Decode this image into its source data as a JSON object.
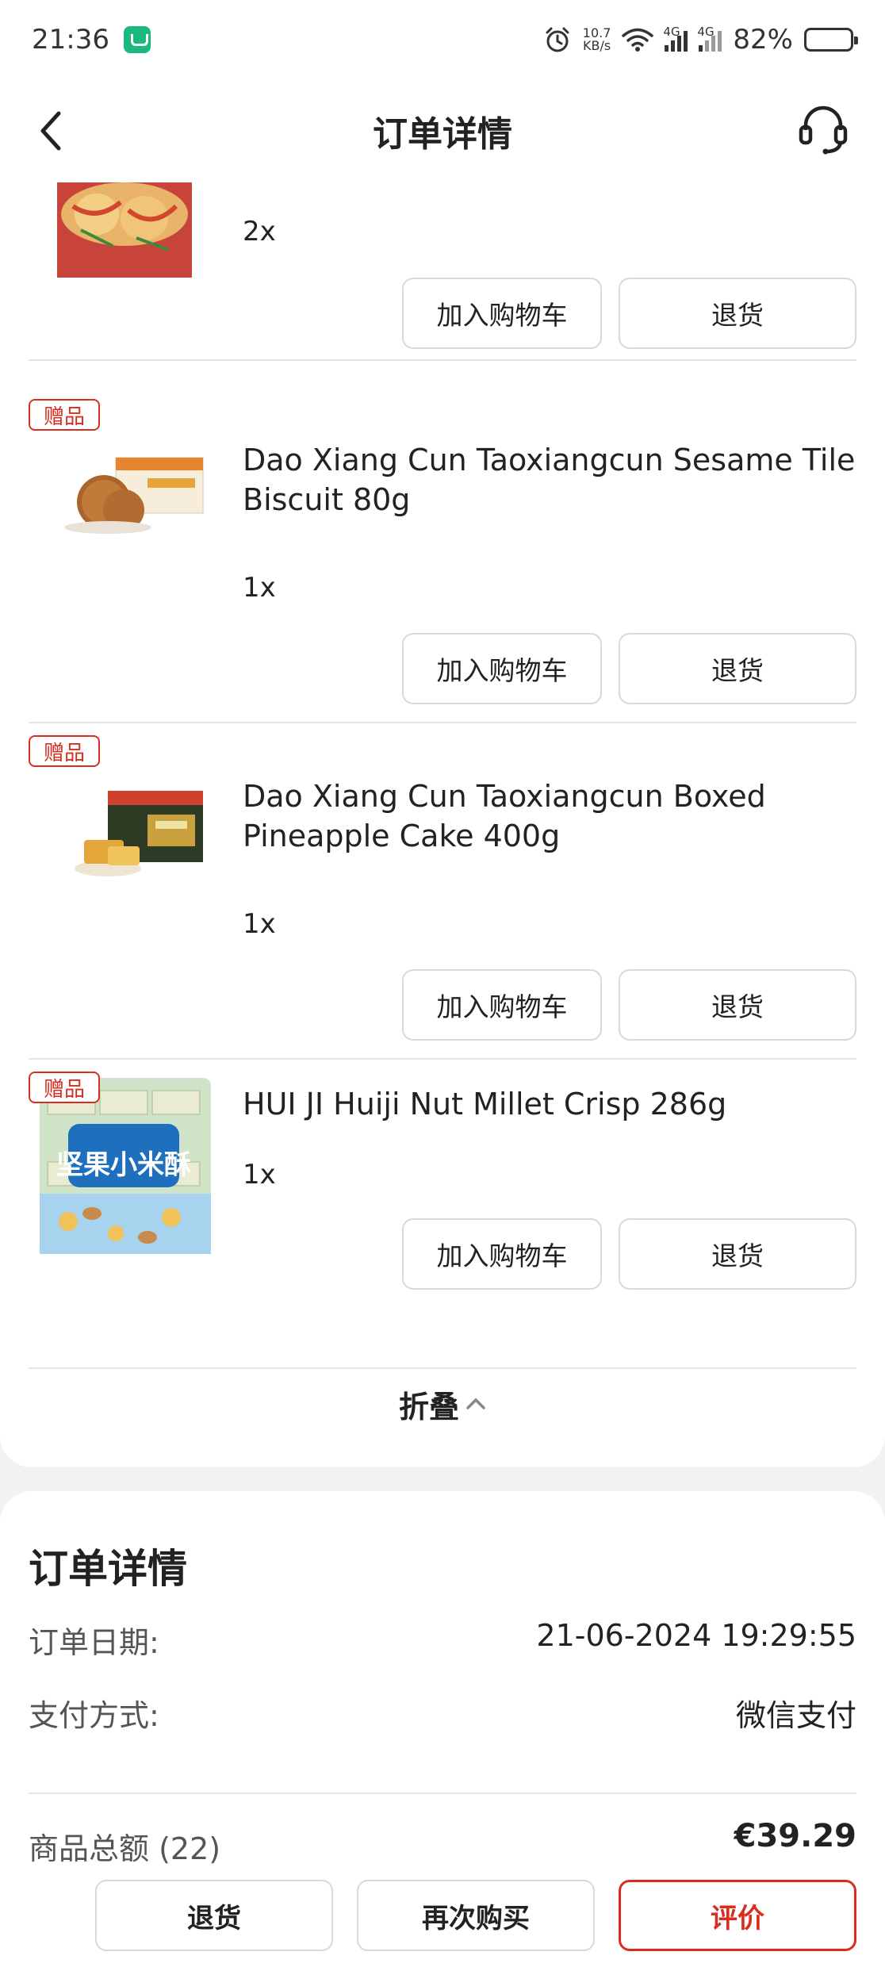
{
  "status_bar": {
    "time": "21:36",
    "net_speed_value": "10.7",
    "net_speed_unit": "KB/s",
    "net1": "4G",
    "net2": "4G",
    "battery": "82%",
    "battery_level": 0.82
  },
  "header": {
    "title": "订单详情"
  },
  "products": [
    {
      "gift_tag": "",
      "name": "",
      "qty": "2x",
      "add_to_cart": "加入购物车",
      "return": "退货"
    },
    {
      "gift_tag": "赠品",
      "name": "Dao Xiang Cun Taoxiangcun Sesame Tile Biscuit 80g",
      "qty": "1x",
      "add_to_cart": "加入购物车",
      "return": "退货"
    },
    {
      "gift_tag": "赠品",
      "name": "Dao Xiang Cun Taoxiangcun Boxed Pineapple Cake 400g",
      "qty": "1x",
      "add_to_cart": "加入购物车",
      "return": "退货"
    },
    {
      "gift_tag": "赠品",
      "name": "HUI JI Huiji Nut Millet Crisp 286g",
      "qty": "1x",
      "add_to_cart": "加入购物车",
      "return": "退货",
      "image_text": "坚果小米酥"
    }
  ],
  "collapse_label": "折叠",
  "order_detail": {
    "heading": "订单详情",
    "date_label": "订单日期:",
    "date_value": "21-06-2024 19:29:55",
    "payment_label": "支付方式:",
    "payment_value": "微信支付",
    "total_label": "商品总额",
    "total_count": "(22)",
    "total_value": "€39.29"
  },
  "bottom_actions": {
    "return": "退货",
    "buy_again": "再次购买",
    "review": "评价"
  },
  "colors": {
    "accent": "#d92d20",
    "border": "#d9d9d9",
    "background": "#f2f2f2"
  }
}
